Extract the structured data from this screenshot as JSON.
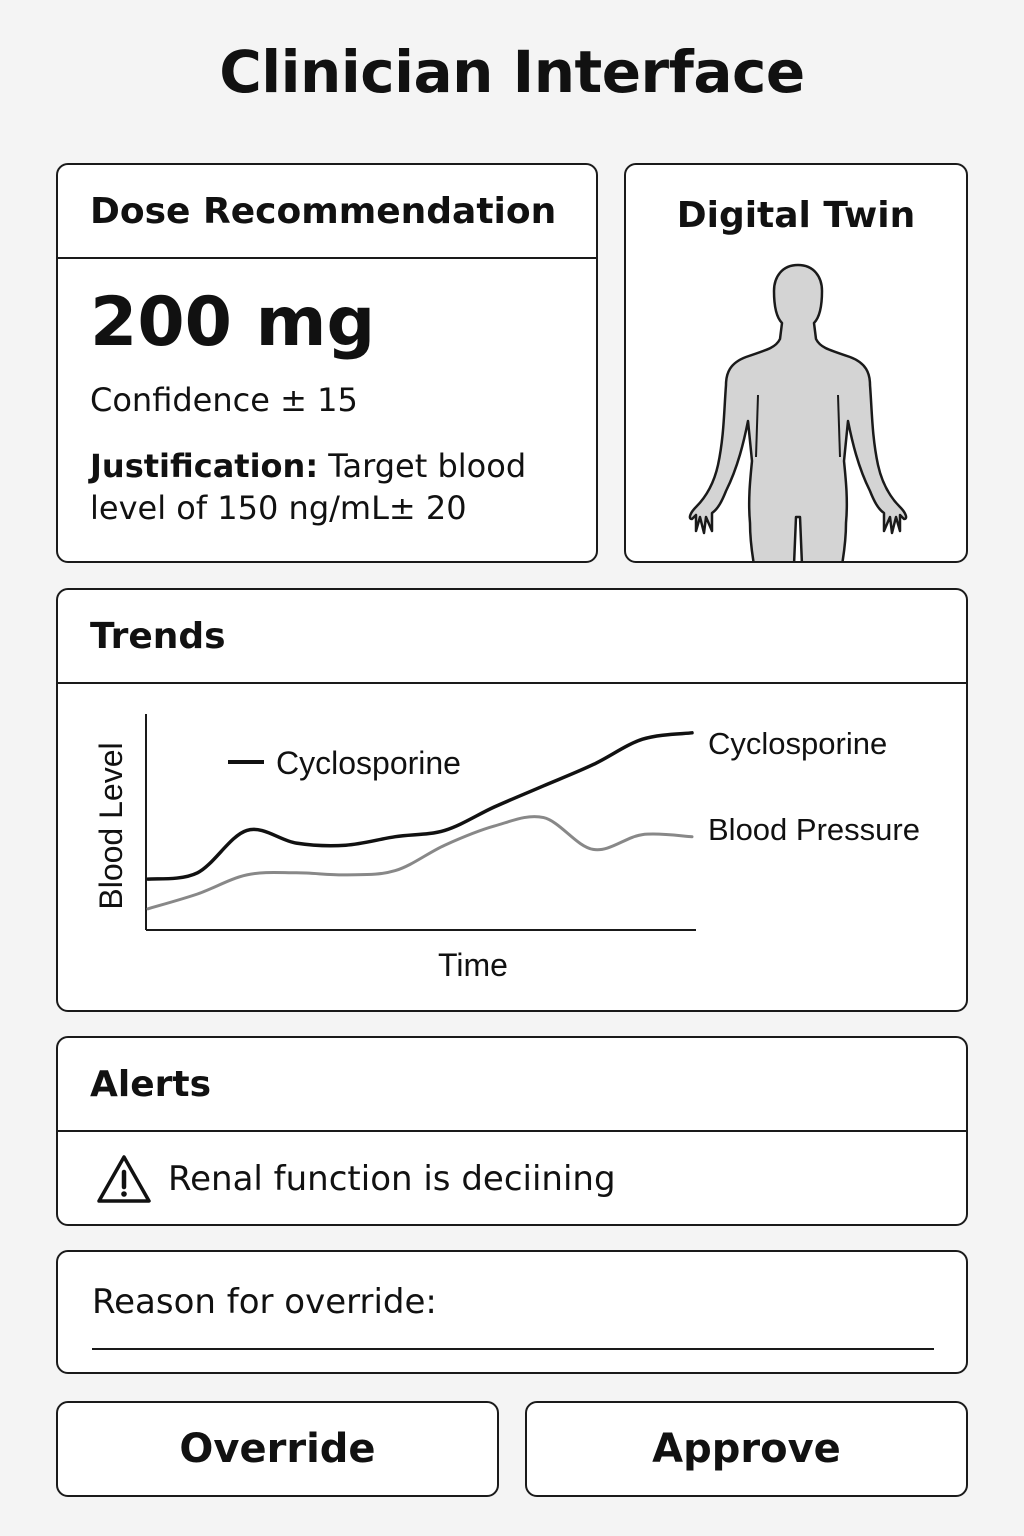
{
  "page": {
    "title": "Clinician Interface"
  },
  "dose": {
    "header": "Dose Recommendation",
    "value": "200 mg",
    "confidence": "Confidence ± 15",
    "justification_label": "Justification:",
    "justification_text": " Target blood level of 150 ng/mL± 20"
  },
  "twin": {
    "title": "Digital Twin",
    "icon": "human-body-silhouette"
  },
  "trends": {
    "header": "Trends",
    "legend_label": "Cyclosporine",
    "series_labels": [
      "Cyclosporine",
      "Blood Pressure"
    ]
  },
  "chart_data": {
    "type": "line",
    "title": "",
    "xlabel": "Time",
    "ylabel": "Blood Level",
    "grid": false,
    "x": [
      0,
      1,
      2,
      3,
      4,
      5,
      6,
      7,
      8,
      9,
      10,
      11
    ],
    "series": [
      {
        "name": "Cyclosporine",
        "color": "#111111",
        "values": [
          24,
          27,
          47,
          41,
          40,
          44,
          47,
          58,
          68,
          78,
          90,
          93
        ]
      },
      {
        "name": "Blood Pressure",
        "color": "#888888",
        "values": [
          10,
          17,
          26,
          27,
          26,
          28,
          40,
          49,
          53,
          38,
          45,
          44
        ]
      }
    ],
    "ylim": [
      0,
      100
    ]
  },
  "alerts": {
    "header": "Alerts",
    "items": [
      {
        "icon": "warning-icon",
        "text": "Renal function is deciining"
      }
    ]
  },
  "override_form": {
    "label": "Reason for override:",
    "value": ""
  },
  "buttons": {
    "override": "Override",
    "approve": "Approve"
  }
}
